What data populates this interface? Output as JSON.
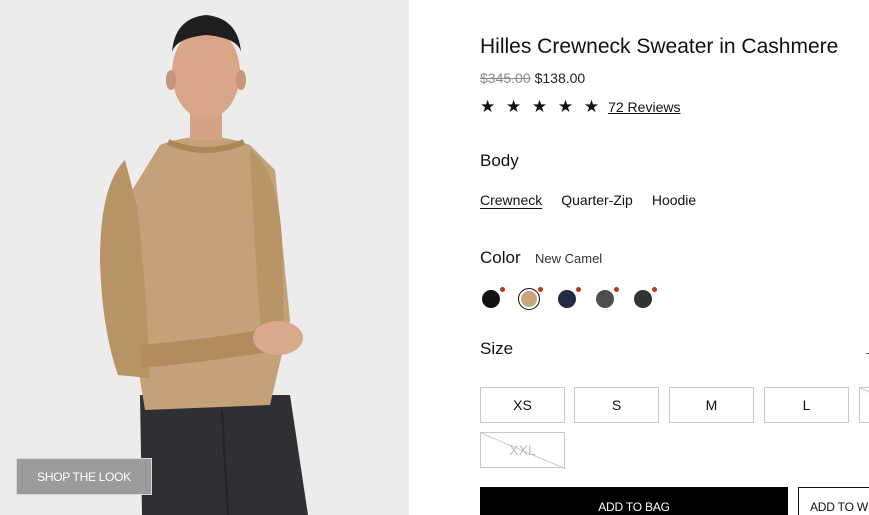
{
  "hero": {
    "shop_the_look": "SHOP THE LOOK"
  },
  "product": {
    "title": "Hilles Crewneck Sweater in Cashmere",
    "price_original": "$345.00",
    "price_sale": "$138.00",
    "rating_stars": "★ ★ ★ ★ ★",
    "rating_value": 5,
    "reviews_label": "72 Reviews"
  },
  "body": {
    "label": "Body",
    "options": [
      "Crewneck",
      "Quarter-Zip",
      "Hoodie"
    ],
    "selected": "Crewneck"
  },
  "color": {
    "label": "Color",
    "selected_name": "New Camel",
    "swatches": [
      {
        "color": "#111111",
        "selected": false
      },
      {
        "color": "#c9a57c",
        "selected": true
      },
      {
        "color": "#1f2a44",
        "selected": false
      },
      {
        "color": "#4f4f4f",
        "selected": false
      },
      {
        "color": "#333335",
        "selected": false
      }
    ],
    "dot_color": "#b8371d"
  },
  "size": {
    "label": "Size",
    "options": [
      {
        "label": "XS",
        "available": true
      },
      {
        "label": "S",
        "available": true
      },
      {
        "label": "M",
        "available": true
      },
      {
        "label": "L",
        "available": true
      },
      {
        "label": "",
        "available": false
      },
      {
        "label": "XXL",
        "available": false
      }
    ]
  },
  "actions": {
    "add_to_bag": "ADD TO BAG",
    "add_to_wishlist": "ADD TO WI"
  }
}
